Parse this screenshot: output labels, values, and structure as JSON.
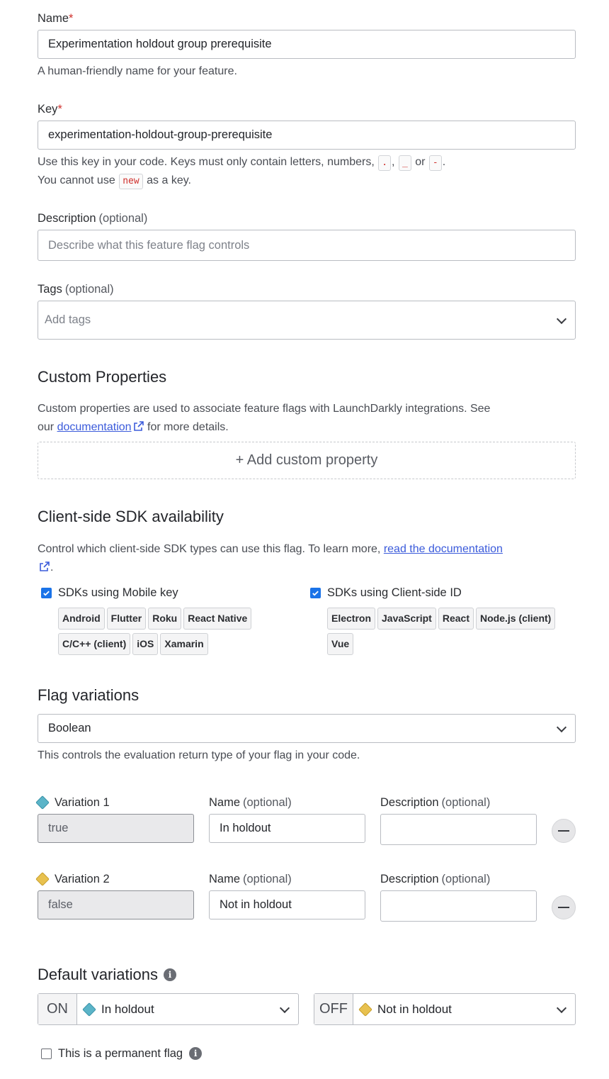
{
  "name_field": {
    "label": "Name",
    "required": "*",
    "value": "Experimentation holdout group prerequisite",
    "help": "A human-friendly name for your feature."
  },
  "key_field": {
    "label": "Key",
    "required": "*",
    "value": "experimentation-holdout-group-prerequisite",
    "help_prefix": "Use this key in your code. Keys must only contain letters, numbers,",
    "char_dot": ".",
    "comma": ",",
    "char_underscore": "_",
    "or": "or",
    "char_dash": "-",
    "period": ".",
    "help2_prefix": "You cannot use",
    "reserved": "new",
    "help2_suffix": "as a key."
  },
  "description_field": {
    "label": "Description",
    "optional": "(optional)",
    "placeholder": "Describe what this feature flag controls"
  },
  "tags_field": {
    "label": "Tags",
    "optional": "(optional)",
    "placeholder": "Add tags"
  },
  "custom_properties": {
    "title": "Custom Properties",
    "help_prefix": "Custom properties are used to associate feature flags with LaunchDarkly integrations. See",
    "help_our": "our",
    "link": "documentation",
    "help_suffix": "for more details.",
    "add_label": "+ Add custom property"
  },
  "sdk": {
    "title": "Client-side SDK availability",
    "help": "Control which client-side SDK types can use this flag. To learn more,",
    "link": "read the documentation",
    "link_end": ".",
    "mobile": {
      "label": "SDKs using Mobile key",
      "chips": [
        "Android",
        "Flutter",
        "Roku",
        "React Native",
        "C/C++ (client)",
        "iOS",
        "Xamarin"
      ]
    },
    "client": {
      "label": "SDKs using Client-side ID",
      "chips": [
        "Electron",
        "JavaScript",
        "React",
        "Node.js (client)",
        "Vue"
      ]
    }
  },
  "variations": {
    "title": "Flag variations",
    "type": "Boolean",
    "help": "This controls the evaluation return type of your flag in your code.",
    "name_label": "Name",
    "desc_label": "Description",
    "optional": "(optional)",
    "items": [
      {
        "label": "Variation 1",
        "value": "true",
        "name": "In holdout",
        "color": "#5bb4c8"
      },
      {
        "label": "Variation 2",
        "value": "false",
        "name": "Not in holdout",
        "color": "#e8c14f"
      }
    ]
  },
  "defaults": {
    "title": "Default variations",
    "on_label": "ON",
    "on_value": "In holdout",
    "off_label": "OFF",
    "off_value": "Not in holdout"
  },
  "permanent": {
    "label": "This is a permanent flag"
  }
}
